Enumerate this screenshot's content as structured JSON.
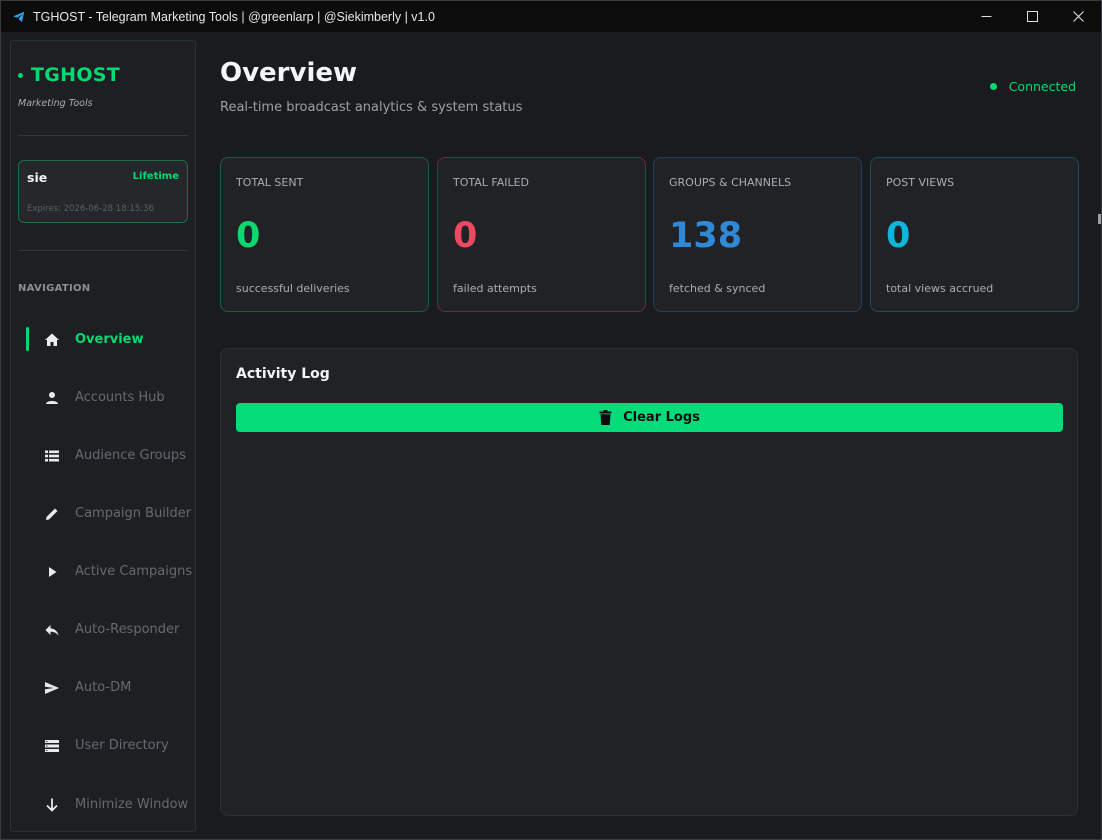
{
  "window": {
    "title": "TGHOST - Telegram Marketing Tools | @greenlarp | @Siekimberly | v1.0",
    "controls": [
      "minimize-icon",
      "maximize-icon",
      "close-icon"
    ]
  },
  "sidebar": {
    "brand": "TGHOST",
    "brand_sub": "Marketing Tools",
    "license": {
      "user": "sie",
      "plan": "Lifetime",
      "expires": "Expires: 2026-06-28 18:15:36"
    },
    "nav_heading": "NAVIGATION",
    "items": [
      {
        "label": "Overview",
        "icon": "home-icon",
        "active": true
      },
      {
        "label": "Accounts Hub",
        "icon": "person-icon"
      },
      {
        "label": "Audience Groups",
        "icon": "list-icon"
      },
      {
        "label": "Campaign Builder",
        "icon": "pencil-icon"
      },
      {
        "label": "Active Campaigns",
        "icon": "play-icon"
      },
      {
        "label": "Auto-Responder",
        "icon": "reply-icon"
      },
      {
        "label": "Auto-DM",
        "icon": "send-icon"
      },
      {
        "label": "User Directory",
        "icon": "storage-icon"
      },
      {
        "label": "Minimize Window",
        "icon": "arrow-down-icon"
      }
    ]
  },
  "header": {
    "title": "Overview",
    "subtitle": "Real-time broadcast analytics & system status",
    "status": "Connected"
  },
  "stats": [
    {
      "label": "TOTAL SENT",
      "value": "0",
      "caption": "successful deliveries",
      "color": "#0ed76f",
      "border": "#1d5c3f"
    },
    {
      "label": "TOTAL FAILED",
      "value": "0",
      "caption": "failed attempts",
      "color": "#ee4761",
      "border": "#6a2a36"
    },
    {
      "label": "GROUPS & CHANNELS",
      "value": "138",
      "caption": "fetched & synced",
      "color": "#3089d6",
      "border": "#24415a"
    },
    {
      "label": "POST VIEWS",
      "value": "0",
      "caption": "total views accrued",
      "color": "#0eb6dc",
      "border": "#1e4e5e"
    }
  ],
  "log": {
    "title": "Activity Log",
    "clear_label": "Clear Logs"
  },
  "colors": {
    "accent": "#06d873",
    "background": "#1a1b1f",
    "card": "#202226"
  }
}
